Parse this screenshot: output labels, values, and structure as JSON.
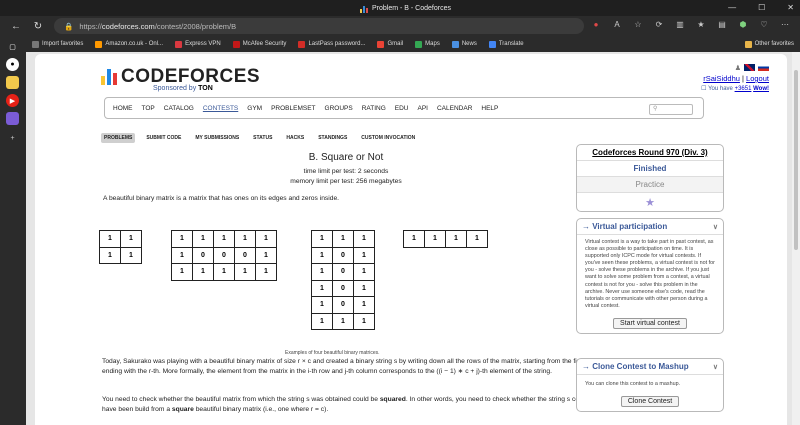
{
  "browser": {
    "tab_title": "Problem - B - Codeforces",
    "url_scheme": "https://",
    "url_host": "codeforces.com",
    "url_path": "/contest/2008/problem/B",
    "bookmarks": [
      {
        "label": "Import favorites",
        "color": "#777777"
      },
      {
        "label": "Amazon.co.uk - Onl...",
        "color": "#ff9900"
      },
      {
        "label": "Express VPN",
        "color": "#da3940"
      },
      {
        "label": "McAfee Security",
        "color": "#c01818"
      },
      {
        "label": "LastPass password...",
        "color": "#d32d27"
      },
      {
        "label": "Gmail",
        "color": "#ea4335"
      },
      {
        "label": "Maps",
        "color": "#34a853"
      },
      {
        "label": "News",
        "color": "#4a90e2"
      },
      {
        "label": "Translate",
        "color": "#4285f4"
      }
    ],
    "other_favorites": "Other favorites"
  },
  "site": {
    "logo_text": "CODEFORCES",
    "sponsor_prefix": "Sponsored by",
    "sponsor_name": "TON",
    "username": "rSaiSiddhu",
    "logout": "Logout",
    "you_have_prefix": "You have",
    "you_have_count": "+3651",
    "you_have_suffix": "Wow!",
    "menu": [
      "HOME",
      "TOP",
      "CATALOG",
      "CONTESTS",
      "GYM",
      "PROBLEMSET",
      "GROUPS",
      "RATING",
      "EDU",
      "API",
      "CALENDAR",
      "HELP"
    ],
    "active_menu": "CONTESTS",
    "submenu": [
      "PROBLEMS",
      "SUBMIT CODE",
      "MY SUBMISSIONS",
      "STATUS",
      "HACKS",
      "STANDINGS",
      "CUSTOM INVOCATION"
    ]
  },
  "problem": {
    "title": "B. Square or Not",
    "time_limit": "time limit per test: 2 seconds",
    "memory_limit": "memory limit per test: 256 megabytes",
    "intro": "A beautiful binary matrix is a matrix that has ones on its edges and zeros inside.",
    "matrices": [
      [
        [
          "1",
          "1"
        ],
        [
          "1",
          "1"
        ]
      ],
      [
        [
          "1",
          "1",
          "1",
          "1",
          "1"
        ],
        [
          "1",
          "0",
          "0",
          "0",
          "1"
        ],
        [
          "1",
          "1",
          "1",
          "1",
          "1"
        ]
      ],
      [
        [
          "1",
          "1",
          "1"
        ],
        [
          "1",
          "0",
          "1"
        ],
        [
          "1",
          "0",
          "1"
        ],
        [
          "1",
          "0",
          "1"
        ],
        [
          "1",
          "0",
          "1"
        ],
        [
          "1",
          "1",
          "1"
        ]
      ],
      [
        [
          "1",
          "1",
          "1",
          "1"
        ]
      ]
    ],
    "caption": "Examples of four beautiful binary matrices.",
    "para1": "Today, Sakurako was playing with a beautiful binary matrix of size r × c and created a binary string s by writing down all the rows of the matrix, starting from the first and ending with the r-th. More formally, the element from the matrix in the i-th row and j-th column corresponds to the ((i − 1) ∗ c + j)-th element of the string.",
    "para2_a": "You need to check whether the beautiful matrix from which the string s was obtained could be ",
    "para2_b": "squared",
    "para2_c": ". In other words, you need to check whether the string s could have been build from a ",
    "para2_d": "square",
    "para2_e": " beautiful binary matrix (i.e., one where r = c)."
  },
  "sidebar": {
    "round_title": "Codeforces Round 970 (Div. 3)",
    "status": "Finished",
    "practice": "Practice",
    "virtual_title": "→ Virtual participation",
    "virtual_text": "Virtual contest is a way to take part in past contest, as close as possible to participation on time. It is supported only ICPC mode for virtual contests. If you've seen these problems, a virtual contest is not for you - solve these problems in the archive. If you just want to solve some problem from a contest, a virtual contest is not for you - solve this problem in the archive. Never use someone else's code, read the tutorials or communicate with other person during a virtual contest.",
    "virtual_button": "Start virtual contest",
    "clone_title": "→ Clone Contest to Mashup",
    "clone_text": "You can clone this contest to a mashup.",
    "clone_button": "Clone Contest"
  }
}
